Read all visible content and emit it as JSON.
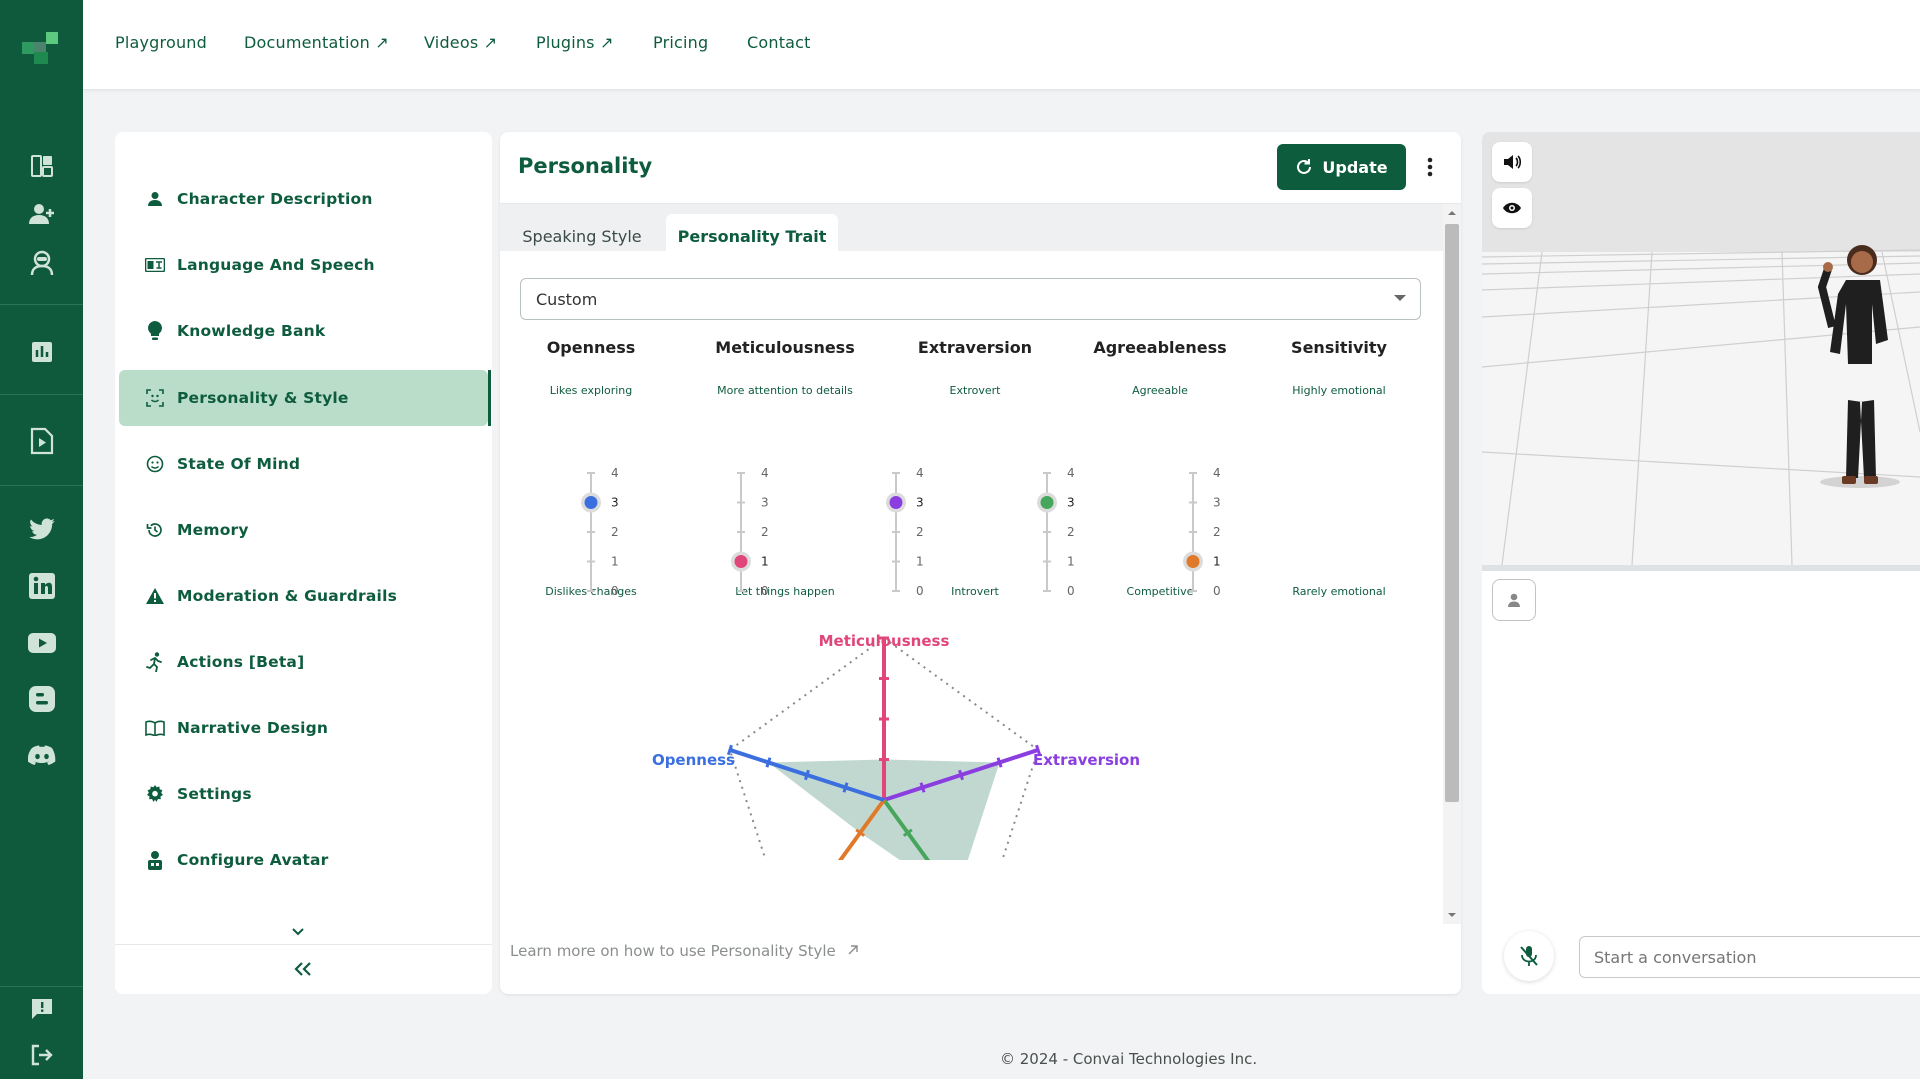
{
  "nav": {
    "items": [
      {
        "label": "Playground"
      },
      {
        "label": "Documentation ↗"
      },
      {
        "label": "Videos ↗"
      },
      {
        "label": "Plugins ↗"
      },
      {
        "label": "Pricing"
      },
      {
        "label": "Contact"
      }
    ]
  },
  "menu": {
    "items": [
      {
        "label": "Character Description",
        "icon": "person-icon"
      },
      {
        "label": "Language And Speech",
        "icon": "language-icon"
      },
      {
        "label": "Knowledge Bank",
        "icon": "lightbulb-icon"
      },
      {
        "label": "Personality & Style",
        "icon": "face-scan-icon"
      },
      {
        "label": "State Of Mind",
        "icon": "mood-icon"
      },
      {
        "label": "Memory",
        "icon": "history-icon"
      },
      {
        "label": "Moderation & Guardrails",
        "icon": "warning-icon"
      },
      {
        "label": "Actions [Beta]",
        "icon": "running-icon"
      },
      {
        "label": "Narrative Design",
        "icon": "book-icon"
      },
      {
        "label": "Settings",
        "icon": "gear-icon"
      },
      {
        "label": "Configure Avatar",
        "icon": "avatar-icon"
      }
    ],
    "active": "Personality & Style"
  },
  "panel": {
    "title": "Personality",
    "update_label": "Update",
    "tabs": [
      {
        "label": "Speaking Style"
      },
      {
        "label": "Personality Trait"
      }
    ],
    "active_tab": "Personality Trait",
    "preset": "Custom",
    "learn_more": "Learn more on how to use Personality Style"
  },
  "traits": [
    {
      "name": "Openness",
      "high": "Likes exploring",
      "low": "Dislikes changes",
      "value": 3,
      "color": "#3b6fe0"
    },
    {
      "name": "Meticulousness",
      "high": "More attention to details",
      "low": "Let things happen",
      "value": 1,
      "color": "#e0467a"
    },
    {
      "name": "Extraversion",
      "high": "Extrovert",
      "low": "Introvert",
      "value": 3,
      "color": "#8a3ee0"
    },
    {
      "name": "Agreeableness",
      "high": "Agreeable",
      "low": "Competitive",
      "value": 3,
      "color": "#46a65c"
    },
    {
      "name": "Sensitivity",
      "high": "Highly emotional",
      "low": "Rarely emotional",
      "value": 1,
      "color": "#e07a2a"
    }
  ],
  "scale_ticks": [
    "4",
    "3",
    "2",
    "1",
    "0"
  ],
  "chart_data": {
    "type": "radar",
    "axes": [
      "Meticulousness",
      "Extraversion",
      "Agreeableness",
      "Sensitivity",
      "Openness"
    ],
    "values": [
      1,
      3,
      3,
      1,
      3
    ],
    "range": [
      0,
      4
    ],
    "axis_colors": [
      "#e0467a",
      "#8a3ee0",
      "#46a65c",
      "#e07a2a",
      "#3b6fe0"
    ],
    "visible_labels": [
      "Meticulousness",
      "Openness",
      "Extraversion"
    ],
    "fill": "#b6d1c9"
  },
  "chat": {
    "placeholder": "Start a conversation"
  },
  "footer": "© 2024 - Convai Technologies Inc."
}
